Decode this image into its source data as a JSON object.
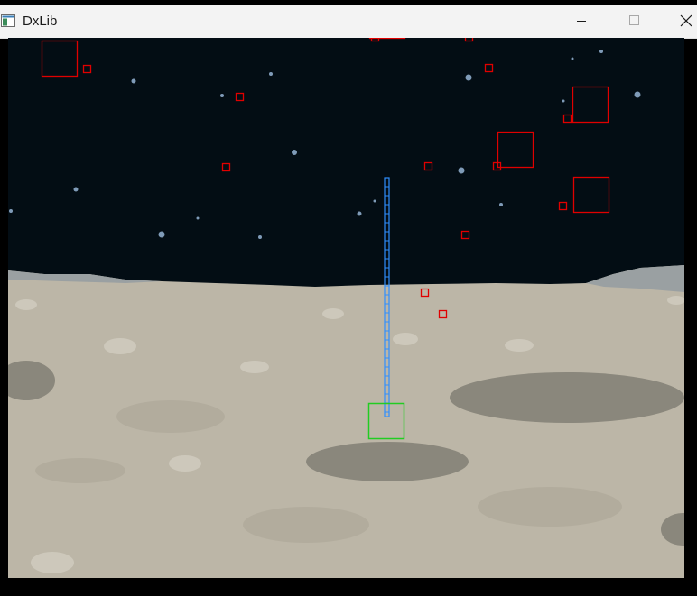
{
  "window": {
    "title": "DxLib"
  },
  "titlebar_icons": {
    "app": "app-window-icon",
    "minimize": "minimize-icon",
    "maximize": "maximize-icon",
    "close": "close-icon"
  },
  "colors": {
    "sky": "#030d14",
    "ground": "#bcb6a7",
    "crater": "#8a877c",
    "star": "#7f9bb8",
    "enemy_hitbox": "#e00000",
    "bullet_hitbox": "#e00000",
    "player_hitbox": "#22cc22",
    "laser": "#2f8fff"
  },
  "game": {
    "player_hitbox": {
      "label": "player"
    },
    "laser": {
      "label": "laser-beam"
    },
    "enemy_hitbox_count": 5,
    "bullet_hitbox_count": 13
  }
}
